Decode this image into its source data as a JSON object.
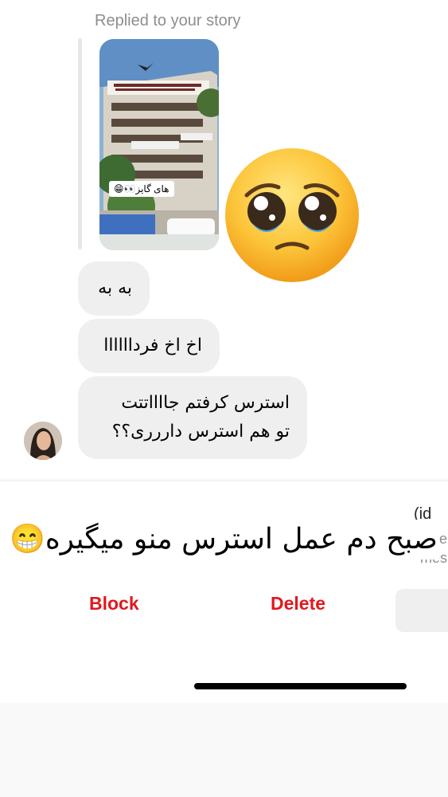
{
  "story_reply": {
    "label": "Replied to your story",
    "story_caption": "های گایز👀😁",
    "reaction": "pleading-face-emoji"
  },
  "messages": [
    {
      "lines": [
        "به به"
      ]
    },
    {
      "lines": [
        "اخ اخ فرداااااا"
      ]
    },
    {
      "lines": [
        "استرس کرفتم جااااتتت",
        "تو هم استرس داررری؟؟"
      ]
    }
  ],
  "sender": {
    "avatar": "avatar"
  },
  "overlay": {
    "text": "صبح دم عمل استرس منو میگیره😁"
  },
  "request_sheet": {
    "cut_line_1": "(id",
    "cut_line_2": "d se",
    "cut_line_3": "mes",
    "block_label": "Block",
    "delete_label": "Delete"
  },
  "colors": {
    "danger": "#e0181e",
    "bubble": "#efefef",
    "secondary_text": "#8e8e8e"
  }
}
